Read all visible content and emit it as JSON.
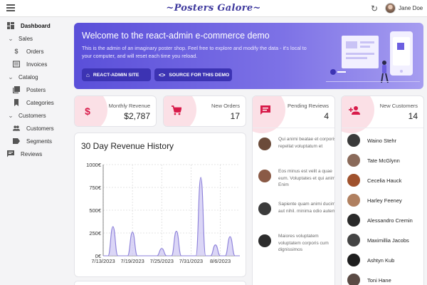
{
  "appbar": {
    "title": "~Posters Galore~",
    "user_name": "Jane Doe"
  },
  "sidebar": {
    "items": [
      {
        "label": "Dashboard",
        "icon": "dashboard-icon"
      },
      {
        "label": "Sales",
        "icon": "chevron-down-icon"
      },
      {
        "label": "Orders",
        "icon": "dollar-icon"
      },
      {
        "label": "Invoices",
        "icon": "invoice-icon"
      },
      {
        "label": "Catalog",
        "icon": "chevron-down-icon"
      },
      {
        "label": "Posters",
        "icon": "collections-icon"
      },
      {
        "label": "Categories",
        "icon": "bookmark-icon"
      },
      {
        "label": "Customers",
        "icon": "chevron-down-icon"
      },
      {
        "label": "Customers",
        "icon": "people-icon"
      },
      {
        "label": "Segments",
        "icon": "label-icon"
      },
      {
        "label": "Reviews",
        "icon": "comment-icon"
      }
    ]
  },
  "banner": {
    "title": "Welcome to the react-admin e-commerce demo",
    "text": "This is the admin of an imaginary poster shop. Feel free to explore and modify the data - it's local to your computer, and will reset each time you reload.",
    "button_site": "REACT-ADMIN SITE",
    "button_source": "SOURCE FOR THIS DEMO"
  },
  "stats": {
    "revenue": {
      "label": "Monthly Revenue",
      "value": "$2,787"
    },
    "orders": {
      "label": "New Orders",
      "value": "17"
    },
    "reviews": {
      "label": "Pending Reviews",
      "value": "4"
    },
    "customers": {
      "label": "New Customers",
      "value": "14"
    }
  },
  "reviews": [
    {
      "text": "Qui animi beatae et corporis repellat voluptatum et",
      "avatar_color": "#6b4b3a"
    },
    {
      "text": "Eos minus est velit a quae eum. Voluptates et qui animi. Enim",
      "avatar_color": "#8a5a46"
    },
    {
      "text": "Sapiente quam animi ducimus aut nihil. minima odio autem.",
      "avatar_color": "#3b3b3b"
    },
    {
      "text": "Maiores voluptatem voluptatem corporis cum dignissimos",
      "avatar_color": "#2c2c2c"
    }
  ],
  "customers": [
    {
      "name": "Waino Stehr",
      "avatar_color": "#3a3a3a"
    },
    {
      "name": "Tate McGlynn",
      "avatar_color": "#8a6a5a"
    },
    {
      "name": "Cecelia Hauck",
      "avatar_color": "#a0522d"
    },
    {
      "name": "Harley Feeney",
      "avatar_color": "#b08060"
    },
    {
      "name": "Alessandro Cremin",
      "avatar_color": "#2a2a2a"
    },
    {
      "name": "Maximillia Jacobs",
      "avatar_color": "#444444"
    },
    {
      "name": "Ashtyn Kub",
      "avatar_color": "#1e1e1e"
    },
    {
      "name": "Toni Hane",
      "avatar_color": "#5a4a44"
    }
  ],
  "chart_data": {
    "type": "area",
    "title": "30 Day Revenue History",
    "ylabel": "",
    "xlabel": "",
    "ylim": [
      0,
      1000
    ],
    "y_ticks": [
      "0€",
      "250€",
      "500€",
      "750€",
      "1000€"
    ],
    "x_ticks": [
      "7/13/2023",
      "7/19/2023",
      "7/25/2023",
      "7/31/2023",
      "8/6/2023"
    ],
    "x_range": [
      "2023-07-13",
      "2023-08-10"
    ],
    "points": [
      {
        "x": "2023-07-13",
        "y": 0
      },
      {
        "x": "2023-07-14",
        "y": 0
      },
      {
        "x": "2023-07-15",
        "y": 320
      },
      {
        "x": "2023-07-16",
        "y": 0
      },
      {
        "x": "2023-07-17",
        "y": 0
      },
      {
        "x": "2023-07-18",
        "y": 0
      },
      {
        "x": "2023-07-19",
        "y": 260
      },
      {
        "x": "2023-07-20",
        "y": 0
      },
      {
        "x": "2023-07-21",
        "y": 0
      },
      {
        "x": "2023-07-22",
        "y": 0
      },
      {
        "x": "2023-07-23",
        "y": 0
      },
      {
        "x": "2023-07-24",
        "y": 0
      },
      {
        "x": "2023-07-25",
        "y": 80
      },
      {
        "x": "2023-07-26",
        "y": 0
      },
      {
        "x": "2023-07-27",
        "y": 0
      },
      {
        "x": "2023-07-28",
        "y": 270
      },
      {
        "x": "2023-07-29",
        "y": 0
      },
      {
        "x": "2023-07-30",
        "y": 0
      },
      {
        "x": "2023-07-31",
        "y": 0
      },
      {
        "x": "2023-08-01",
        "y": 0
      },
      {
        "x": "2023-08-02",
        "y": 860
      },
      {
        "x": "2023-08-03",
        "y": 0
      },
      {
        "x": "2023-08-04",
        "y": 0
      },
      {
        "x": "2023-08-05",
        "y": 120
      },
      {
        "x": "2023-08-06",
        "y": 0
      },
      {
        "x": "2023-08-07",
        "y": 0
      },
      {
        "x": "2023-08-08",
        "y": 210
      },
      {
        "x": "2023-08-09",
        "y": 0
      },
      {
        "x": "2023-08-10",
        "y": 0
      }
    ],
    "grid": true,
    "colors": {
      "line": "#8b7fd9",
      "fill": "#cfc8f3"
    }
  },
  "colors": {
    "accent": "#5a4fd9",
    "stat_icon": "#d81b4a",
    "stat_icon_bg": "#fbe0e6"
  }
}
